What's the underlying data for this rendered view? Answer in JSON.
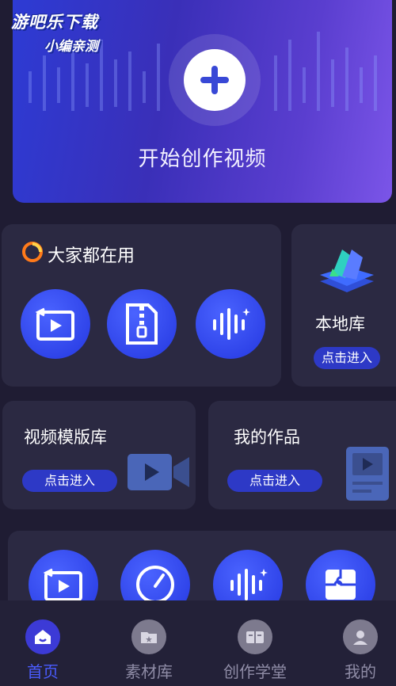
{
  "watermark": {
    "line1": "游吧乐下载",
    "line2": "小编亲测"
  },
  "hero": {
    "label": "开始创作视频"
  },
  "everyone_card": {
    "title": "大家都在用",
    "tools": [
      {
        "icon": "video-playback-icon"
      },
      {
        "icon": "zip-file-icon"
      },
      {
        "icon": "audio-wave-icon"
      }
    ]
  },
  "local_library": {
    "title": "本地库",
    "enter": "点击进入"
  },
  "template_library": {
    "title": "视频模版库",
    "enter": "点击进入"
  },
  "my_works": {
    "title": "我的作品",
    "enter": "点击进入"
  },
  "more_tools": [
    {
      "icon": "video-playback-icon"
    },
    {
      "icon": "speedometer-icon"
    },
    {
      "icon": "audio-wave-icon"
    },
    {
      "icon": "puzzle-icon"
    }
  ],
  "tabs": [
    {
      "label": "首页",
      "icon": "home-icon",
      "active": true
    },
    {
      "label": "素材库",
      "icon": "folder-icon",
      "active": false
    },
    {
      "label": "创作学堂",
      "icon": "book-icon",
      "active": false
    },
    {
      "label": "我的",
      "icon": "user-icon",
      "active": false
    }
  ],
  "colors": {
    "accent": "#2d39c6",
    "active_tab": "#4a5cff",
    "card_bg": "#2b2942"
  }
}
